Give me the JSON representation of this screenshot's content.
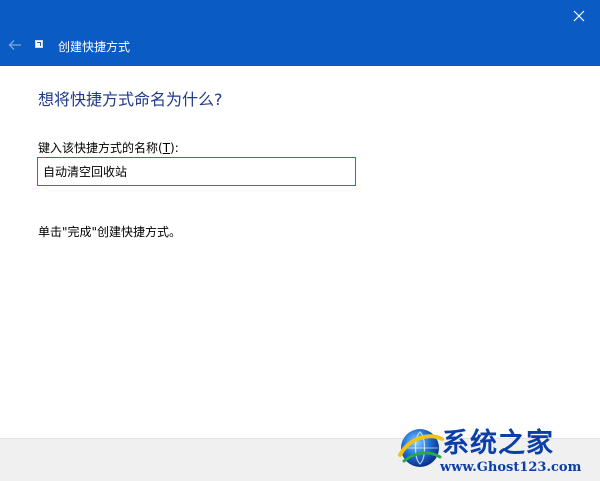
{
  "window": {
    "title": "创建快捷方式",
    "close_icon": "close-icon",
    "back_icon": "back-arrow-icon",
    "app_icon": "shortcut-icon",
    "titlebar_color": "#0a5bc4"
  },
  "page": {
    "heading": "想将快捷方式命名为什么?",
    "field_label_prefix": "键入该快捷方式的名称(",
    "field_label_key": "T",
    "field_label_suffix": "):",
    "input_value": "自动清空回收站",
    "hint": "单击\"完成\"创建快捷方式。"
  },
  "watermark": {
    "title": "系统之家",
    "url": "www.Ghost123.com"
  }
}
